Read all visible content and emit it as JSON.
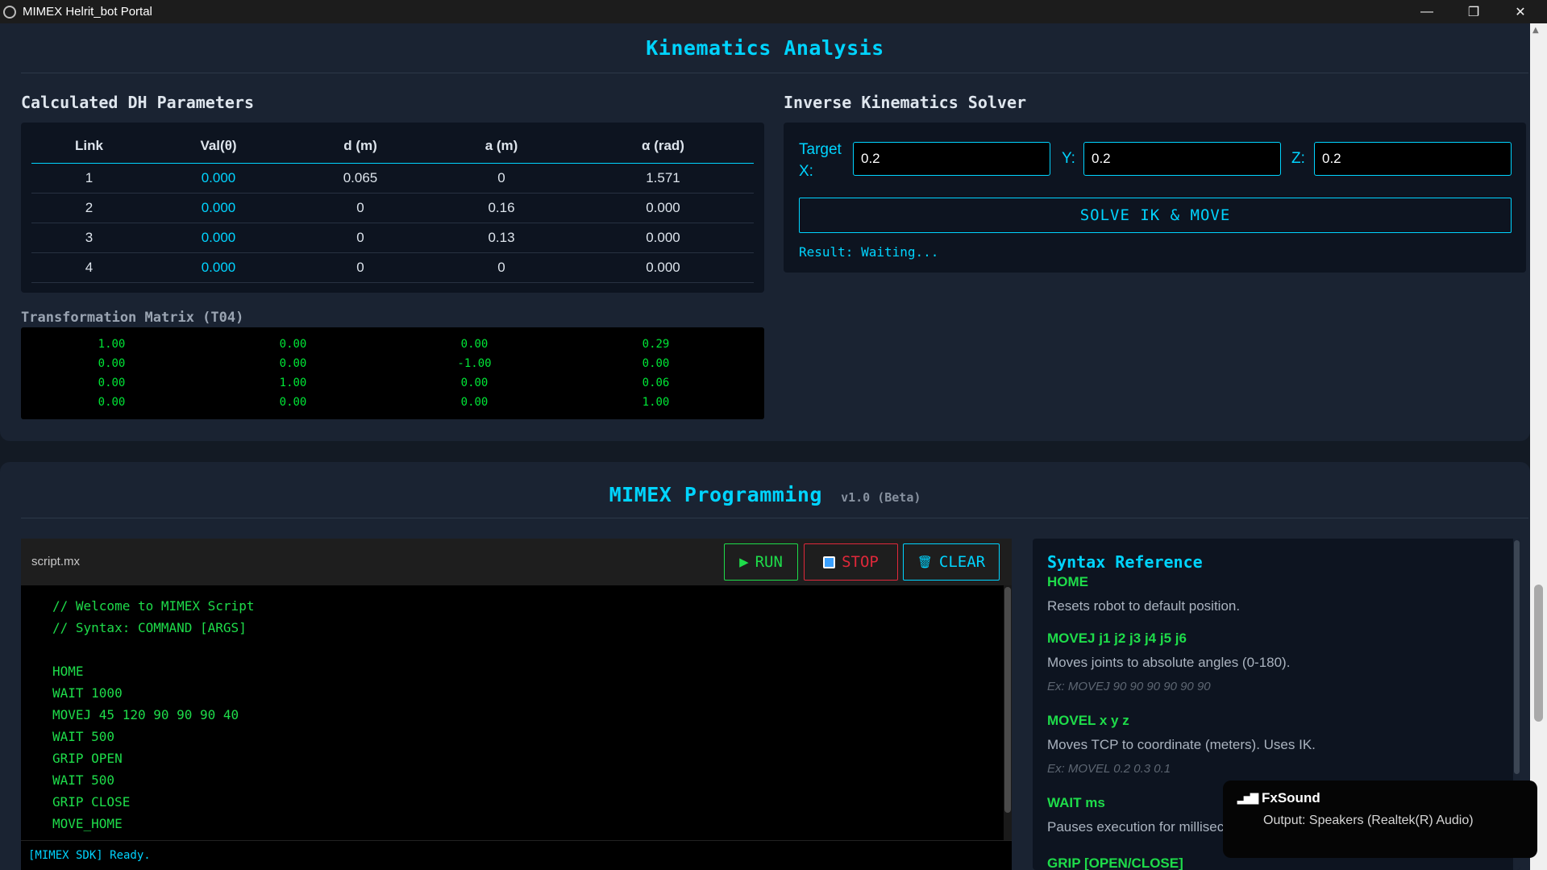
{
  "window": {
    "title": "MIMEX Helrit_bot Portal",
    "minimize": "—",
    "restore": "❐",
    "close": "✕"
  },
  "kinematics": {
    "title": "Kinematics Analysis",
    "dh": {
      "title": "Calculated DH Parameters",
      "headers": [
        "Link",
        "Val(θ)",
        "d (m)",
        "a (m)",
        "α (rad)"
      ],
      "rows": [
        [
          "1",
          "0.000",
          "0.065",
          "0",
          "1.571"
        ],
        [
          "2",
          "0.000",
          "0",
          "0.16",
          "0.000"
        ],
        [
          "3",
          "0.000",
          "0",
          "0.13",
          "0.000"
        ],
        [
          "4",
          "0.000",
          "0",
          "0",
          "0.000"
        ]
      ]
    },
    "matrix": {
      "title": "Transformation Matrix (T04)",
      "rows": [
        [
          "1.00",
          "0.00",
          "0.00",
          "0.29"
        ],
        [
          "0.00",
          "0.00",
          "-1.00",
          "0.00"
        ],
        [
          "0.00",
          "1.00",
          "0.00",
          "0.06"
        ],
        [
          "0.00",
          "0.00",
          "0.00",
          "1.00"
        ]
      ]
    },
    "ik": {
      "title": "Inverse Kinematics Solver",
      "label_x": "Target X:",
      "label_y": "Y:",
      "label_z": "Z:",
      "x": "0.2",
      "y": "0.2",
      "z": "0.2",
      "button": "SOLVE IK & MOVE",
      "result": "Result: Waiting..."
    }
  },
  "programming": {
    "title": "MIMEX Programming",
    "version": "v1.0 (Beta)",
    "filename": "script.mx",
    "run": "RUN",
    "stop": "STOP",
    "clear": "CLEAR",
    "code_lines": [
      "// Welcome to MIMEX Script",
      "// Syntax: COMMAND [ARGS]",
      "",
      "HOME",
      "WAIT 1000",
      "MOVEJ 45 120 90 90 90 40",
      "WAIT 500",
      "GRIP OPEN",
      "WAIT 500",
      "GRIP CLOSE",
      "MOVE_HOME"
    ],
    "console": "[MIMEX SDK] Ready."
  },
  "syntax": {
    "title": "Syntax Reference",
    "home_cmd": "HOME",
    "home_desc": "Resets robot to default position.",
    "movej_cmd": "MOVEJ j1 j2 j3 j4 j5 j6",
    "movej_desc": "Moves joints to absolute angles (0-180).",
    "movej_ex": "Ex: MOVEJ 90 90 90 90 90 90",
    "movel_cmd": "MOVEL x y z",
    "movel_desc": "Moves TCP to coordinate (meters). Uses IK.",
    "movel_ex": "Ex: MOVEL 0.2 0.3 0.1",
    "wait_cmd": "WAIT ms",
    "wait_desc": "Pauses execution for millisec",
    "grip_cmd": "GRIP [OPEN/CLOSE]"
  },
  "toast": {
    "app": "FxSound",
    "message": "Output: Speakers (Realtek(R) Audio)"
  }
}
